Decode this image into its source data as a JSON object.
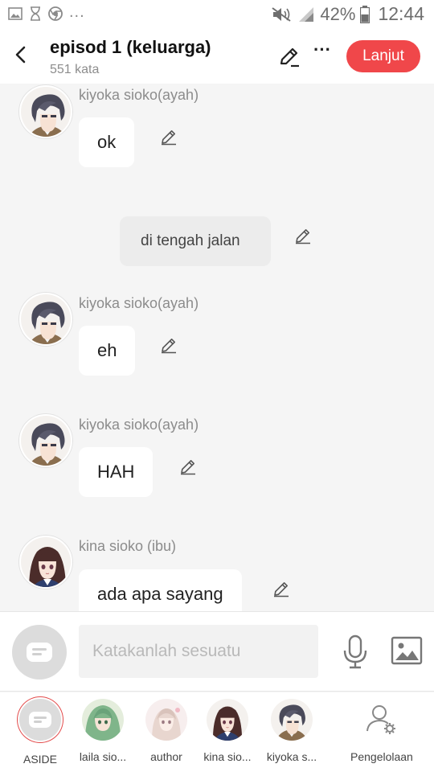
{
  "status_bar": {
    "icons": [
      "image-icon",
      "hourglass-icon",
      "chrome-icon"
    ],
    "more": "...",
    "right_icons": [
      "mute-icon",
      "signal-icon"
    ],
    "battery": "42%",
    "time": "12:44"
  },
  "header": {
    "title": "episod 1 (keluarga)",
    "word_count": "551 kata",
    "next_label": "Lanjut",
    "accent": "#f0474a"
  },
  "messages": [
    {
      "type": "character",
      "name": "kiyoka sioko(ayah)",
      "text": "ok",
      "avatar": "kiyoka"
    },
    {
      "type": "narration",
      "text": "di tengah jalan"
    },
    {
      "type": "character",
      "name": "kiyoka sioko(ayah)",
      "text": "eh",
      "avatar": "kiyoka"
    },
    {
      "type": "character",
      "name": "kiyoka sioko(ayah)",
      "text": "HAH",
      "avatar": "kiyoka"
    },
    {
      "type": "character",
      "name": "kina sioko (ibu)",
      "text": "ada apa sayang",
      "avatar": "kina"
    }
  ],
  "input": {
    "placeholder": "Katakanlah sesuatu",
    "value": ""
  },
  "characters": [
    {
      "label": "ASIDE",
      "avatar": "aside"
    },
    {
      "label": "laila sio...",
      "avatar": "laila"
    },
    {
      "label": "author",
      "avatar": "author"
    },
    {
      "label": "kina sio...",
      "avatar": "kina"
    },
    {
      "label": "kiyoka s...",
      "avatar": "kiyoka"
    },
    {
      "label": "Pengelolaan",
      "avatar": "manage"
    }
  ]
}
